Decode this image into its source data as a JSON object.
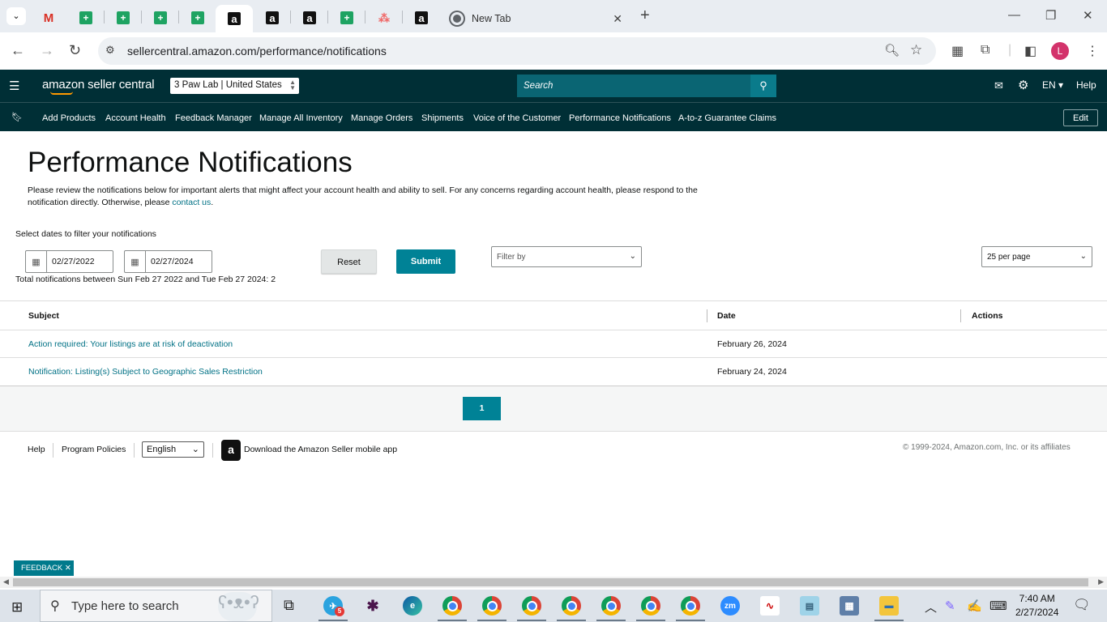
{
  "browser": {
    "active_tab_title": "New Tab",
    "url": "sellercentral.amazon.com/performance/notifications",
    "profile_initial": "L"
  },
  "header": {
    "logo_text": "amazon seller central",
    "store_selector": "3 Paw Lab | United States",
    "search_placeholder": "Search",
    "language": "EN",
    "help": "Help"
  },
  "nav": {
    "items": [
      "Add Products",
      "Account Health",
      "Feedback Manager",
      "Manage All Inventory",
      "Manage Orders",
      "Shipments",
      "Voice of the Customer",
      "Performance Notifications",
      "A-to-z Guarantee Claims"
    ],
    "edit_label": "Edit"
  },
  "page": {
    "title": "Performance Notifications",
    "intro_1": "Please review the notifications below for important alerts that might affect your account health and ability to sell. For any concerns regarding account health, please respond to the notification directly. Otherwise, please ",
    "intro_link": "contact us",
    "intro_2": ".",
    "filter_label": "Select dates to filter your notifications",
    "date_from": "02/27/2022",
    "date_to": "02/27/2024",
    "reset_label": "Reset",
    "submit_label": "Submit",
    "filter_by": "Filter by",
    "per_page": "25 per page",
    "total_text": "Total notifications between Sun Feb 27 2022 and Tue Feb 27 2024: 2"
  },
  "table": {
    "headers": [
      "Subject",
      "Date",
      "Actions"
    ],
    "rows": [
      {
        "subject": "Action required: Your listings are at risk of deactivation",
        "date": "February 26, 2024"
      },
      {
        "subject": "Notification: Listing(s) Subject to Geographic Sales Restriction",
        "date": "February 24, 2024"
      }
    ]
  },
  "pagination": {
    "current": "1"
  },
  "footer": {
    "help": "Help",
    "policies": "Program Policies",
    "language": "English",
    "app_text": "Download the Amazon Seller mobile app",
    "copyright": "© 1999-2024, Amazon.com, Inc. or its affiliates"
  },
  "feedback_label": "FEEDBACK",
  "taskbar": {
    "search_placeholder": "Type here to search",
    "time": "7:40 AM",
    "date": "2/27/2024",
    "telegram_badge": "5"
  },
  "colors": {
    "header_bg": "#002f36",
    "accent": "#008296",
    "link": "#007185"
  }
}
